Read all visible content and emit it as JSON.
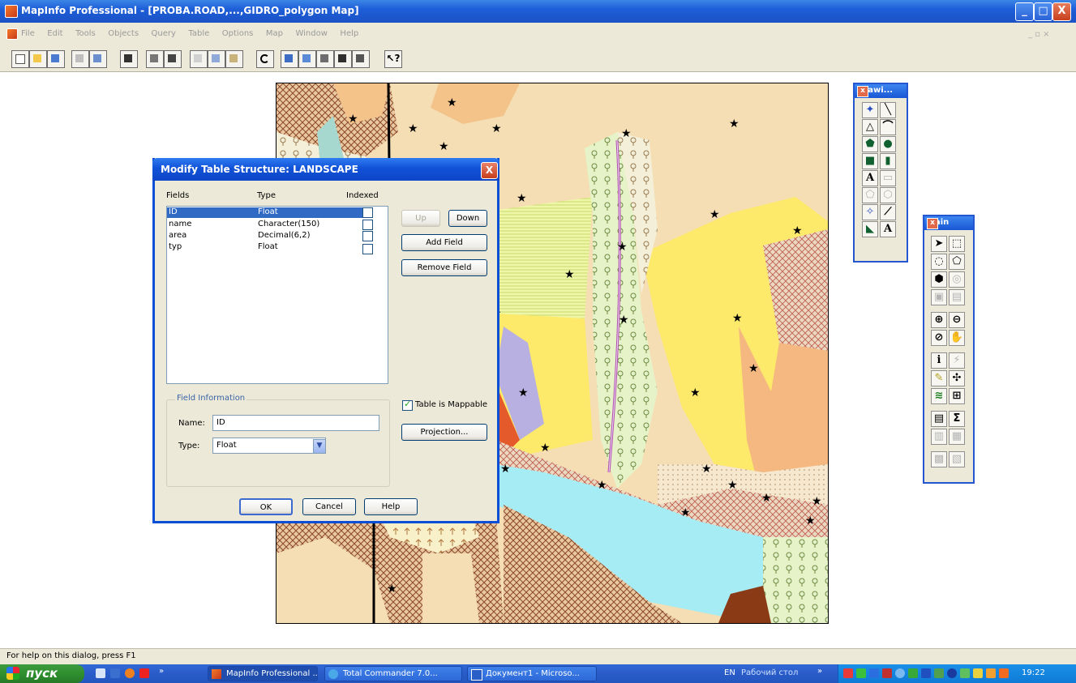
{
  "window": {
    "title": "MapInfo Professional - [PROBA.ROAD,...,GIDRO_polygon Map]",
    "controls": [
      "_",
      "□",
      "X"
    ]
  },
  "menu": {
    "items": [
      "File",
      "Edit",
      "Tools",
      "Objects",
      "Query",
      "Table",
      "Options",
      "Map",
      "Window",
      "Help"
    ]
  },
  "dialog": {
    "title": "Modify Table Structure: LANDSCAPE",
    "close": "X",
    "columns": {
      "fields": "Fields",
      "type": "Type",
      "indexed": "Indexed"
    },
    "rows": [
      {
        "name": "ID",
        "type": "Float",
        "selected": true
      },
      {
        "name": "name",
        "type": "Character(150)",
        "selected": false
      },
      {
        "name": "area",
        "type": "Decimal(6,2)",
        "selected": false
      },
      {
        "name": "typ",
        "type": "Float",
        "selected": false
      }
    ],
    "buttons": {
      "up": "Up",
      "down": "Down",
      "add_field": "Add Field",
      "remove_field": "Remove Field",
      "projection": "Projection...",
      "ok": "OK",
      "cancel": "Cancel",
      "help": "Help"
    },
    "mappable_label": "Table is Mappable",
    "mappable_checked": true,
    "field_info": {
      "group_label": "Field Information",
      "name_label": "Name:",
      "name_value": "ID",
      "type_label": "Type:",
      "type_value": "Float"
    }
  },
  "palettes": {
    "drawing": {
      "title": "Drawi..."
    },
    "main": {
      "title": "Main"
    }
  },
  "status": {
    "help_text": "For help on this dialog, press F1"
  },
  "taskbar": {
    "start_label": "пуск",
    "tasks": [
      "MapInfo Professional ...",
      "Total Commander 7.0...",
      "Документ1 - Microso..."
    ],
    "language": "EN",
    "desktop_label": "Рабочий стол",
    "clock": "19:22"
  },
  "colors": {
    "xp_blue": "#1e5ed8",
    "dialog_face": "#ece9d8",
    "selection": "#316ac5",
    "start_green": "#2f8f2f"
  }
}
